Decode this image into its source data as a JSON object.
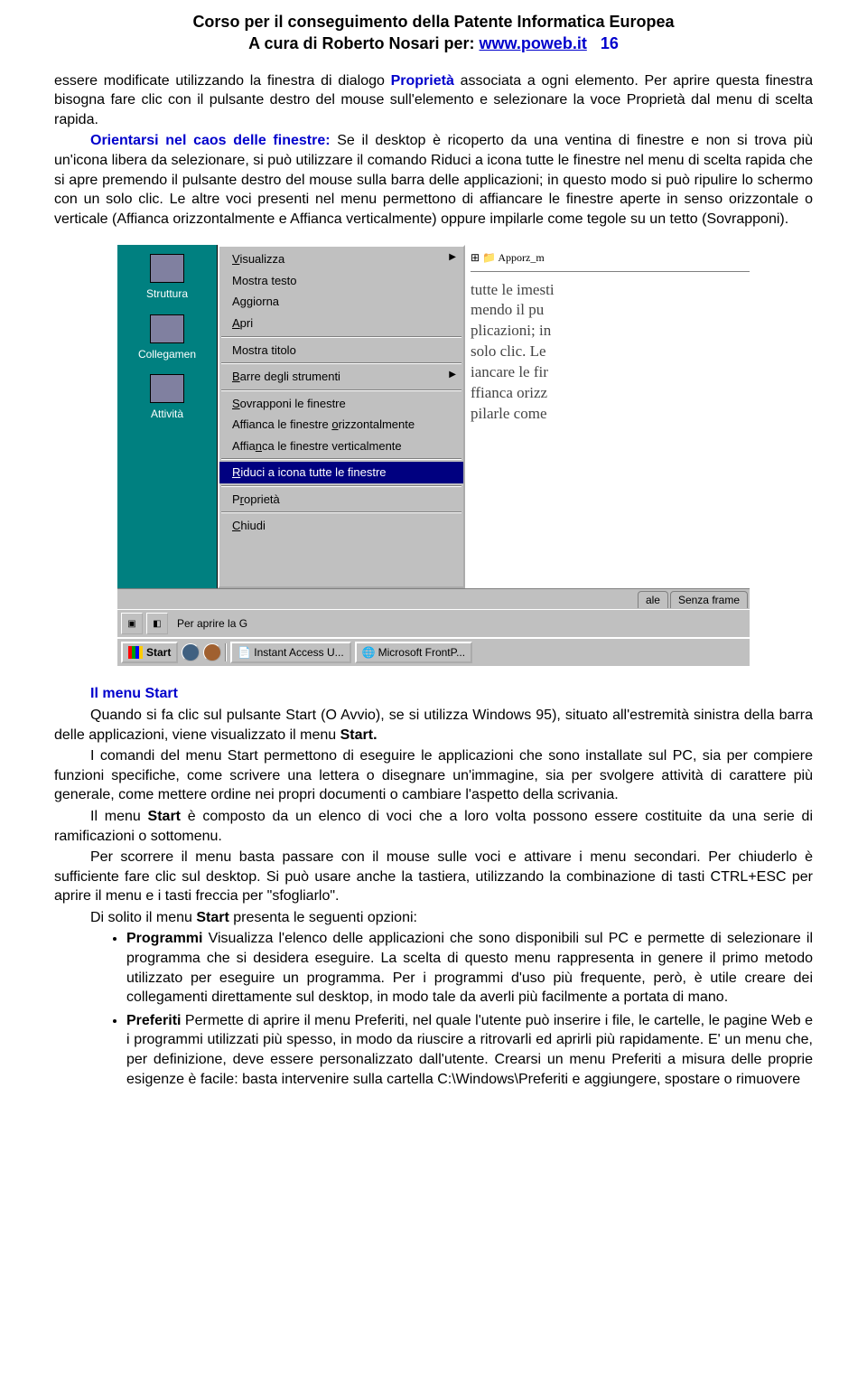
{
  "header": {
    "line1": "Corso per il conseguimento della Patente Informatica Europea",
    "line2_prefix": "A cura di Roberto Nosari per: ",
    "link": "www.poweb.it",
    "page_number": "16"
  },
  "p1": {
    "t1": "essere modificate utilizzando la finestra di dialogo ",
    "b1": "Proprietà",
    "t2": " associata a ogni elemento. Per aprire questa finestra bisogna fare clic con il pulsante destro del mouse sull'elemento e selezionare la voce Proprietà dal menu di scelta rapida."
  },
  "p2": {
    "b1": "Orientarsi nel caos delle finestre:",
    "t1": " Se il desktop è ricoperto da una ventina di finestre e non si trova più un'icona libera da selezionare, si può utilizzare il comando Riduci a icona tutte le finestre nel menu di scelta rapida che si apre premendo il pulsante destro del mouse sulla barra delle applicazioni; in questo modo si può ripulire lo schermo con un solo clic. Le altre voci presenti nel menu permettono di affiancare le finestre aperte in senso orizzontale o verticale (Affianca orizzontalmente e Affianca verticalmente) oppure impilarle come tegole su un tetto (Sovrapponi)."
  },
  "screenshot": {
    "left_labels": [
      "Struttura",
      "Collegamen",
      "Attività"
    ],
    "menu": {
      "visualizza": "Visualizza",
      "mostra_testo": "Mostra testo",
      "aggiorna": "Aggiorna",
      "apri": "Apri",
      "mostra_titolo": "Mostra titolo",
      "barre": "Barre degli strumenti",
      "sovrapponi": "Sovrapponi le finestre",
      "affianca_oriz": "Affianca le finestre orizzontalmente",
      "affianca_vert": "Affianca le finestre verticalmente",
      "riduci": "Riduci a icona tutte le finestre",
      "proprieta": "Proprietà",
      "chiudi": "Chiudi"
    },
    "right_lines": [
      "tutte le imesti",
      "mendo il pu",
      "plicazioni; in",
      "solo clic. Le",
      "iancare le fir",
      "ffianca orizz",
      "pilarle come"
    ],
    "right_top": "Apporz_m",
    "tabs": [
      "ale",
      "Senza frame"
    ],
    "toolbar_text": "Per aprire la G",
    "taskbar": {
      "start": "Start",
      "task1": "Instant Access U...",
      "task2": "Microsoft FrontP..."
    }
  },
  "sec2": {
    "title": "Il menu Start",
    "p1a": "Quando si fa clic sul pulsante Start (O Avvio), se si utilizza Windows 95), situato all'estremità sinistra della barra delle applicazioni, viene visualizzato il menu ",
    "p1b": "Start.",
    "p2": "I comandi del menu Start permettono di eseguire le applicazioni che sono installate sul PC, sia per compiere funzioni specifiche, come scrivere una lettera o disegnare un'immagine, sia per svolgere attività di carattere più generale, come mettere ordine nei propri documenti o cambiare l'aspetto della scrivania.",
    "p3a": "Il menu ",
    "p3b": "Start",
    "p3c": " è composto da un elenco di voci che a loro volta possono essere costituite da una serie di ramificazioni o sottomenu.",
    "p4": "Per scorrere il menu basta passare con il mouse sulle voci e attivare i menu secondari. Per chiuderlo è sufficiente fare clic sul desktop. Si può usare anche la tastiera, utilizzando la combinazione di tasti CTRL+ESC per aprire il menu e i tasti freccia per \"sfogliarlo\".",
    "p5a": "Di solito il menu ",
    "p5b": "Start",
    "p5c": " presenta le seguenti opzioni:",
    "bullet1a": "Programmi",
    "bullet1b": " Visualizza l'elenco delle applicazioni che sono disponibili sul PC e permette di selezionare il programma che si desidera eseguire. La scelta di questo menu rappresenta in genere il primo metodo utilizzato per eseguire un programma. Per i programmi d'uso più frequente, però, è utile creare dei collegamenti direttamente sul desktop, in modo tale da averli più facilmente a portata di mano.",
    "bullet2a": "Preferiti",
    "bullet2b": " Permette di aprire il menu Preferiti, nel quale l'utente può inserire i file, le cartelle, le pagine Web e i programmi utilizzati più spesso, in modo da riuscire a ritrovarli ed aprirli più rapidamente. E' un menu che, per definizione, deve essere personalizzato dall'utente. Crearsi un menu Preferiti a misura delle proprie esigenze è facile: basta intervenire sulla cartella C:\\Windows\\Preferiti e aggiungere, spostare o rimuovere"
  }
}
